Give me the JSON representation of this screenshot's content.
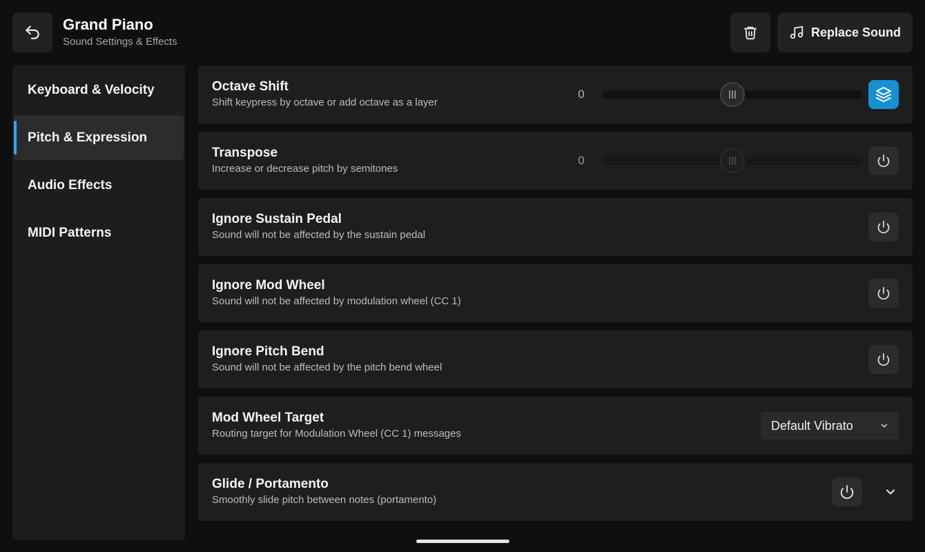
{
  "header": {
    "title": "Grand Piano",
    "subtitle": "Sound Settings & Effects",
    "back_icon": "undo-arrow-icon",
    "delete_icon": "trash-icon",
    "replace_label": "Replace Sound",
    "replace_icon": "music-note-icon"
  },
  "sidebar": {
    "items": [
      {
        "label": "Keyboard & Velocity",
        "active": false
      },
      {
        "label": "Pitch & Expression",
        "active": true
      },
      {
        "label": "Audio Effects",
        "active": false
      },
      {
        "label": "MIDI Patterns",
        "active": false
      }
    ]
  },
  "settings": {
    "octave_shift": {
      "title": "Octave Shift",
      "desc": "Shift keypress by octave or add octave as a layer",
      "value": "0",
      "slider_fraction": 0.5,
      "layer_icon": "layers-icon",
      "layer_active": true
    },
    "transpose": {
      "title": "Transpose",
      "desc": "Increase or decrease pitch by semitones",
      "value": "0",
      "slider_fraction": 0.5,
      "enabled": false
    },
    "ignore_sustain": {
      "title": "Ignore Sustain Pedal",
      "desc": "Sound will not be affected by the sustain pedal"
    },
    "ignore_mod": {
      "title": "Ignore Mod Wheel",
      "desc": "Sound will not be affected by modulation wheel (CC 1)"
    },
    "ignore_pitch": {
      "title": "Ignore Pitch Bend",
      "desc": "Sound will not be affected by the pitch bend wheel"
    },
    "mod_target": {
      "title": "Mod Wheel Target",
      "desc": "Routing target for Modulation Wheel (CC 1) messages",
      "selected": "Default Vibrato"
    },
    "glide": {
      "title": "Glide / Portamento",
      "desc": "Smoothly slide pitch between notes (portamento)"
    }
  },
  "colors": {
    "accent": "#3aa3e8",
    "layer_button": "#1790d1",
    "background": "#0f0f0f",
    "panel": "#1e1e1e"
  }
}
